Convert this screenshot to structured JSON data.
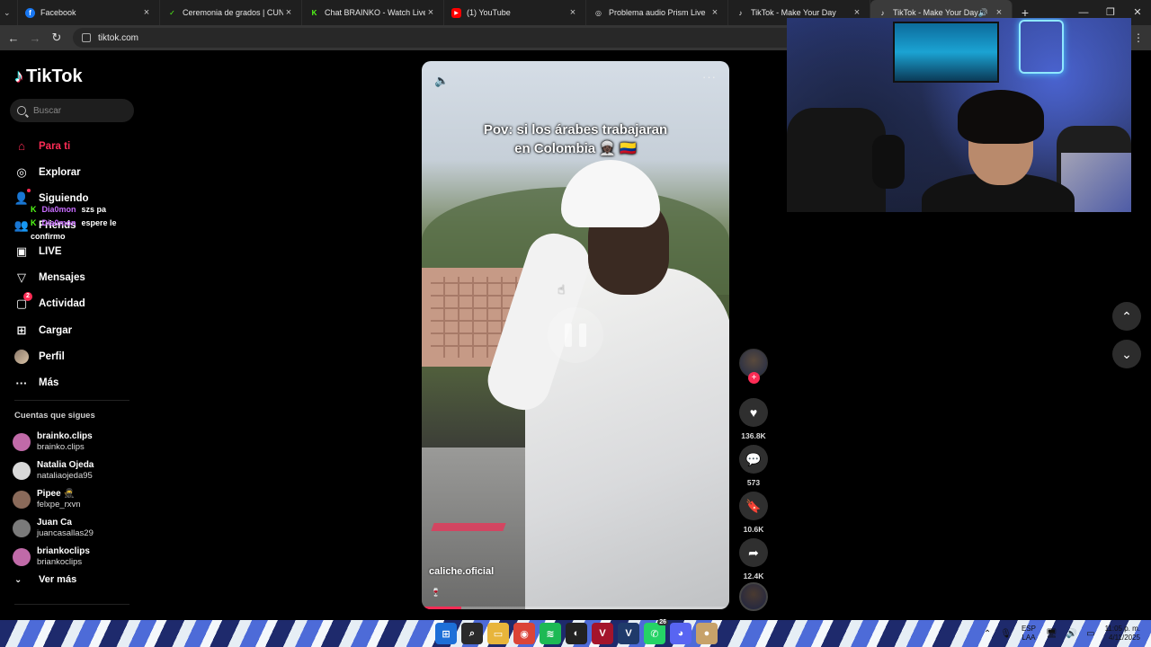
{
  "browser": {
    "tabs": [
      {
        "title": "Facebook",
        "favicon_color": "#1877f2",
        "favicon_glyph": "f",
        "active": false
      },
      {
        "title": "Ceremonia de grados | CUN",
        "favicon_color": "#1f1f1f",
        "favicon_glyph": "✓",
        "active": false
      },
      {
        "title": "Chat BRAINKO - Watch Live on",
        "favicon_color": "#1f1f1f",
        "favicon_glyph": "K",
        "active": false
      },
      {
        "title": "(1) YouTube",
        "favicon_color": "#ff0000",
        "favicon_glyph": "▶",
        "active": false
      },
      {
        "title": "Problema audio Prism Live",
        "favicon_color": "#1f1f1f",
        "favicon_glyph": "◎",
        "active": false
      },
      {
        "title": "TikTok - Make Your Day",
        "favicon_color": "#1f1f1f",
        "favicon_glyph": "♪",
        "active": false
      },
      {
        "title": "TikTok - Make Your Day",
        "favicon_color": "#1f1f1f",
        "favicon_glyph": "♪",
        "active": true
      }
    ],
    "url": "tiktok.com"
  },
  "sidebar": {
    "brand": "TikTok",
    "search_placeholder": "Buscar",
    "nav": [
      {
        "label": "Para ti",
        "icon": "home-icon",
        "active": true
      },
      {
        "label": "Explorar",
        "icon": "compass-icon"
      },
      {
        "label": "Siguiendo",
        "icon": "following-icon"
      },
      {
        "label": "Friends",
        "icon": "friends-icon"
      },
      {
        "label": "LIVE",
        "icon": "live-icon"
      },
      {
        "label": "Mensajes",
        "icon": "messages-icon"
      },
      {
        "label": "Actividad",
        "icon": "activity-icon",
        "badge": "2"
      },
      {
        "label": "Cargar",
        "icon": "upload-icon"
      },
      {
        "label": "Perfil",
        "icon": "profile-icon"
      },
      {
        "label": "Más",
        "icon": "more-icon"
      }
    ],
    "chat_overlay": [
      {
        "user": "Dia0mon",
        "text": "szs pa"
      },
      {
        "user": "Dia0mon",
        "text": "espere le confirmo"
      }
    ],
    "following_title": "Cuentas que sigues",
    "following": [
      {
        "name": "brainko.clips",
        "handle": "brainko.clips",
        "avatar_color": "#c06aa8"
      },
      {
        "name": "Natalia Ojeda",
        "handle": "nataliaojeda95",
        "avatar_color": "#d9d9d9"
      },
      {
        "name": "Pipee 🥷",
        "handle": "felxpe_rxvn",
        "avatar_color": "#8a6a5a"
      },
      {
        "name": "Juan Ca",
        "handle": "juancasallas29",
        "avatar_color": "#7a7a7a"
      },
      {
        "name": "briankoclips",
        "handle": "briankoclips",
        "avatar_color": "#c06aa8"
      }
    ],
    "see_more": "Ver más"
  },
  "video": {
    "caption_line1": "Pov: si los árabes trabajaran",
    "caption_line2": "en Colombia 👳🏿 🇨🇴",
    "author": "caliche.oficial",
    "progress": 0.13
  },
  "actions": {
    "likes": "136.8K",
    "comments": "573",
    "saves": "10.6K",
    "shares": "12.4K"
  },
  "taskbar": {
    "lang_line1": "ESP",
    "lang_line2": "LAA",
    "time": "11:05 p. m.",
    "date": "4/11/2025",
    "whatsapp_count": "26"
  }
}
